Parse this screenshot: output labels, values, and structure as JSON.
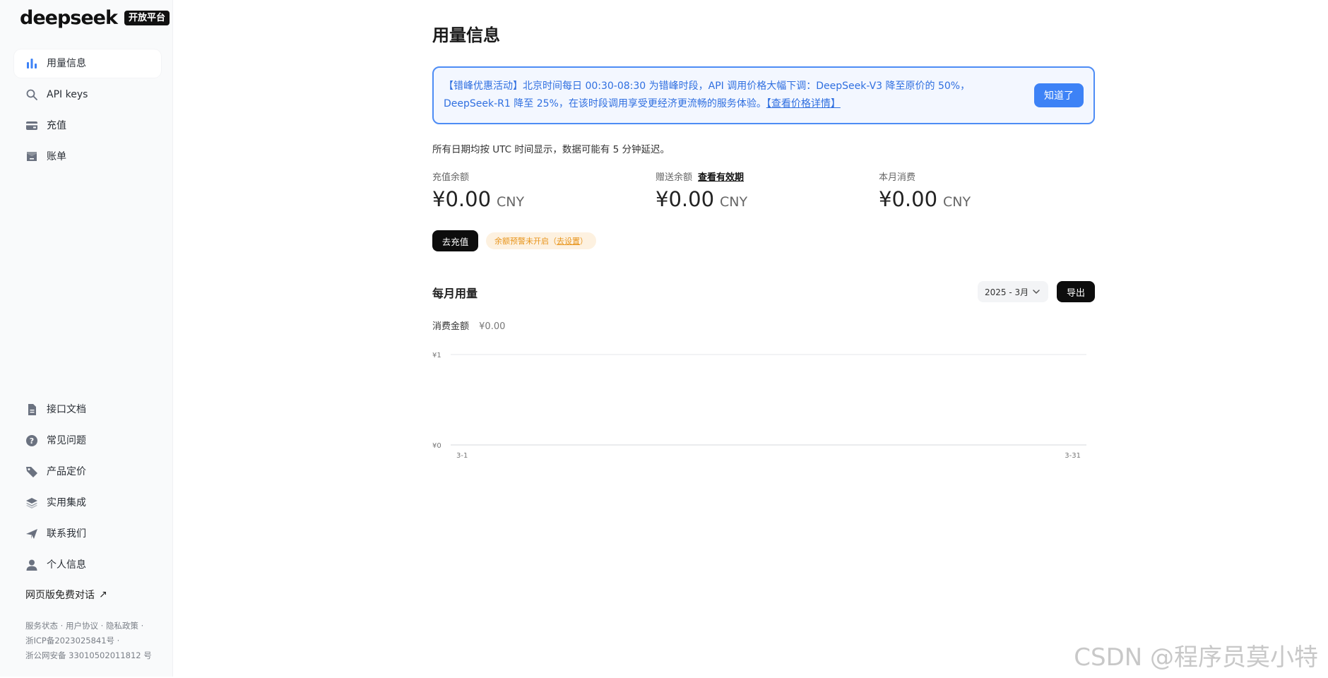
{
  "brand": {
    "name": "deepseek",
    "badge": "开放平台"
  },
  "sidebar": {
    "top_items": [
      {
        "label": "用量信息",
        "icon": "bar-chart-icon",
        "active": true
      },
      {
        "label": "API keys",
        "icon": "search-icon",
        "active": false
      },
      {
        "label": "充值",
        "icon": "wallet-icon",
        "active": false
      },
      {
        "label": "账单",
        "icon": "bill-icon",
        "active": false
      }
    ],
    "bottom_items": [
      {
        "label": "接口文档",
        "icon": "document-icon"
      },
      {
        "label": "常见问题",
        "icon": "question-icon"
      },
      {
        "label": "产品定价",
        "icon": "tag-icon"
      },
      {
        "label": "实用集成",
        "icon": "layers-icon"
      },
      {
        "label": "联系我们",
        "icon": "send-icon"
      },
      {
        "label": "个人信息",
        "icon": "user-icon"
      }
    ],
    "web_chat_link": "网页版免费对话",
    "footer": {
      "service_status": "服务状态",
      "user_agreement": "用户协议",
      "privacy": "隐私政策",
      "icp": "浙ICP备2023025841号",
      "police": "浙公网安备 33010502011812 号"
    }
  },
  "main": {
    "title": "用量信息",
    "banner": {
      "text": "【错峰优惠活动】北京时间每日 00:30-08:30 为错峰时段，API 调用价格大幅下调：DeepSeek-V3 降至原价的 50%，DeepSeek-R1 降至 25%，在该时段调用享受更经济更流畅的服务体验。",
      "link": "【查看价格详情】",
      "button": "知道了"
    },
    "note": "所有日期均按 UTC 时间显示，数据可能有 5 分钟延迟。",
    "stats": [
      {
        "label": "充值余额",
        "value": "¥0.00",
        "unit": "CNY",
        "link": ""
      },
      {
        "label": "赠送余额",
        "value": "¥0.00",
        "unit": "CNY",
        "link": "查看有效期"
      },
      {
        "label": "本月消费",
        "value": "¥0.00",
        "unit": "CNY",
        "link": ""
      }
    ],
    "recharge_button": "去充值",
    "alert": {
      "text": "余额预警未开启（",
      "link": "去设置",
      "suffix": "）"
    },
    "monthly": {
      "title": "每月用量",
      "month": "2025 - 3月",
      "export": "导出",
      "spend_label": "消费金额",
      "spend_value": "¥0.00"
    }
  },
  "chart_data": {
    "type": "line",
    "x_ticks": [
      "3-1",
      "3-31"
    ],
    "y_ticks": [
      "¥1",
      "¥0"
    ],
    "ylim": [
      0,
      1
    ],
    "series": [],
    "grid": true
  },
  "watermark": "CSDN @程序员莫小特",
  "colors": {
    "accent": "#3d82f6",
    "banner_bg": "#f3f7ff",
    "alert": "#e8951c",
    "dark": "#0d0d0d"
  }
}
